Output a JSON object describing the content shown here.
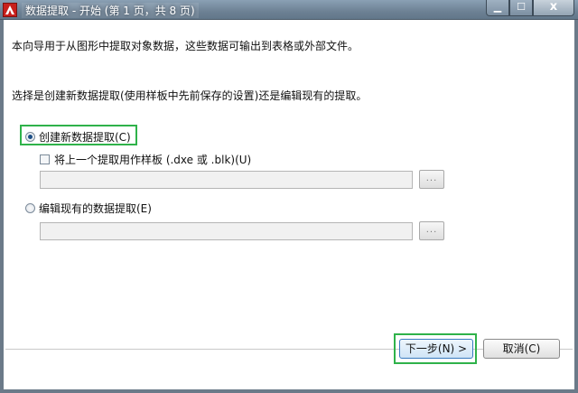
{
  "window": {
    "title": "数据提取 - 开始 (第 1 页，共 8 页)",
    "controls": {
      "minimize": "▁",
      "maximize": "☐",
      "close": "x"
    }
  },
  "intro_text": "本向导用于从图形中提取对象数据，这些数据可输出到表格或外部文件。",
  "question_text": "选择是创建新数据提取(使用样板中先前保存的设置)还是编辑现有的提取。",
  "options": {
    "create_new": {
      "label": "创建新数据提取(C)",
      "checked": true
    },
    "use_template": {
      "label": "将上一个提取用作样板  (.dxe 或 .blk)(U)",
      "checked": false,
      "field_value": "",
      "browse_label": "..."
    },
    "edit_existing": {
      "label": "编辑现有的数据提取(E)",
      "checked": false,
      "field_value": "",
      "browse_label": "..."
    }
  },
  "buttons": {
    "next": "下一步(N) >",
    "cancel": "取消(C)"
  },
  "colors": {
    "highlight": "#2fb24a",
    "titlebar": "#6d8194",
    "app_icon": "#c8201c"
  }
}
